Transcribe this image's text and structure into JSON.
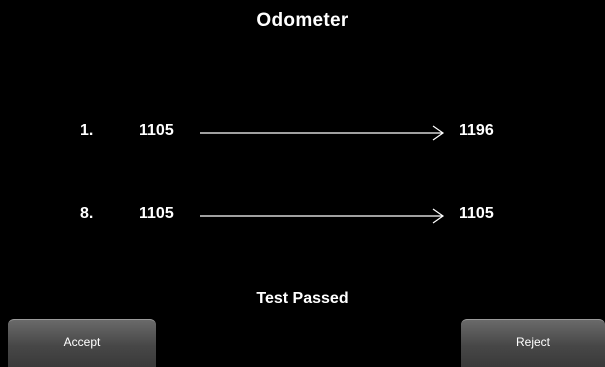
{
  "screen": {
    "title": "Odometer",
    "status": "Test Passed"
  },
  "rows": [
    {
      "index": "1.",
      "from": "1105",
      "to": "1196"
    },
    {
      "index": "8.",
      "from": "1105",
      "to": "1105"
    }
  ],
  "buttons": {
    "accept_label": "Accept",
    "reject_label": "Reject"
  }
}
